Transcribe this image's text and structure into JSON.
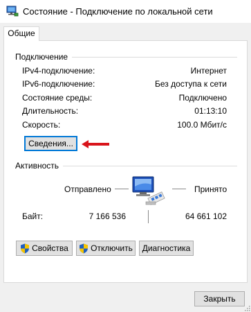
{
  "window": {
    "title": "Состояние - Подключение по локальной сети",
    "icon": "network-connection-icon"
  },
  "tabs": [
    {
      "label": "Общие",
      "selected": true
    }
  ],
  "connection": {
    "group_title": "Подключение",
    "rows": [
      {
        "label": "IPv4-подключение:",
        "value": "Интернет"
      },
      {
        "label": "IPv6-подключение:",
        "value": "Без доступа к сети"
      },
      {
        "label": "Состояние среды:",
        "value": "Подключено"
      },
      {
        "label": "Длительность:",
        "value": "01:13:10"
      },
      {
        "label": "Скорость:",
        "value": "100.0 Мбит/с"
      }
    ],
    "details_button": "Сведения...",
    "arrow_color": "#d9141b"
  },
  "activity": {
    "group_title": "Активность",
    "sent_label": "Отправлено",
    "received_label": "Принято",
    "bytes_label": "Байт:",
    "bytes_sent": "7 166 536",
    "bytes_received": "64 661 102",
    "icon": "network-activity-computer-icon"
  },
  "action_buttons": {
    "properties": "Свойства",
    "disable": "Отключить",
    "diagnose": "Диагностика"
  },
  "close_button": "Закрыть",
  "colors": {
    "focus_border": "#0078d7",
    "button_face": "#e1e1e1",
    "shield_blue": "#1f5fbf",
    "shield_yellow": "#f5c400"
  }
}
